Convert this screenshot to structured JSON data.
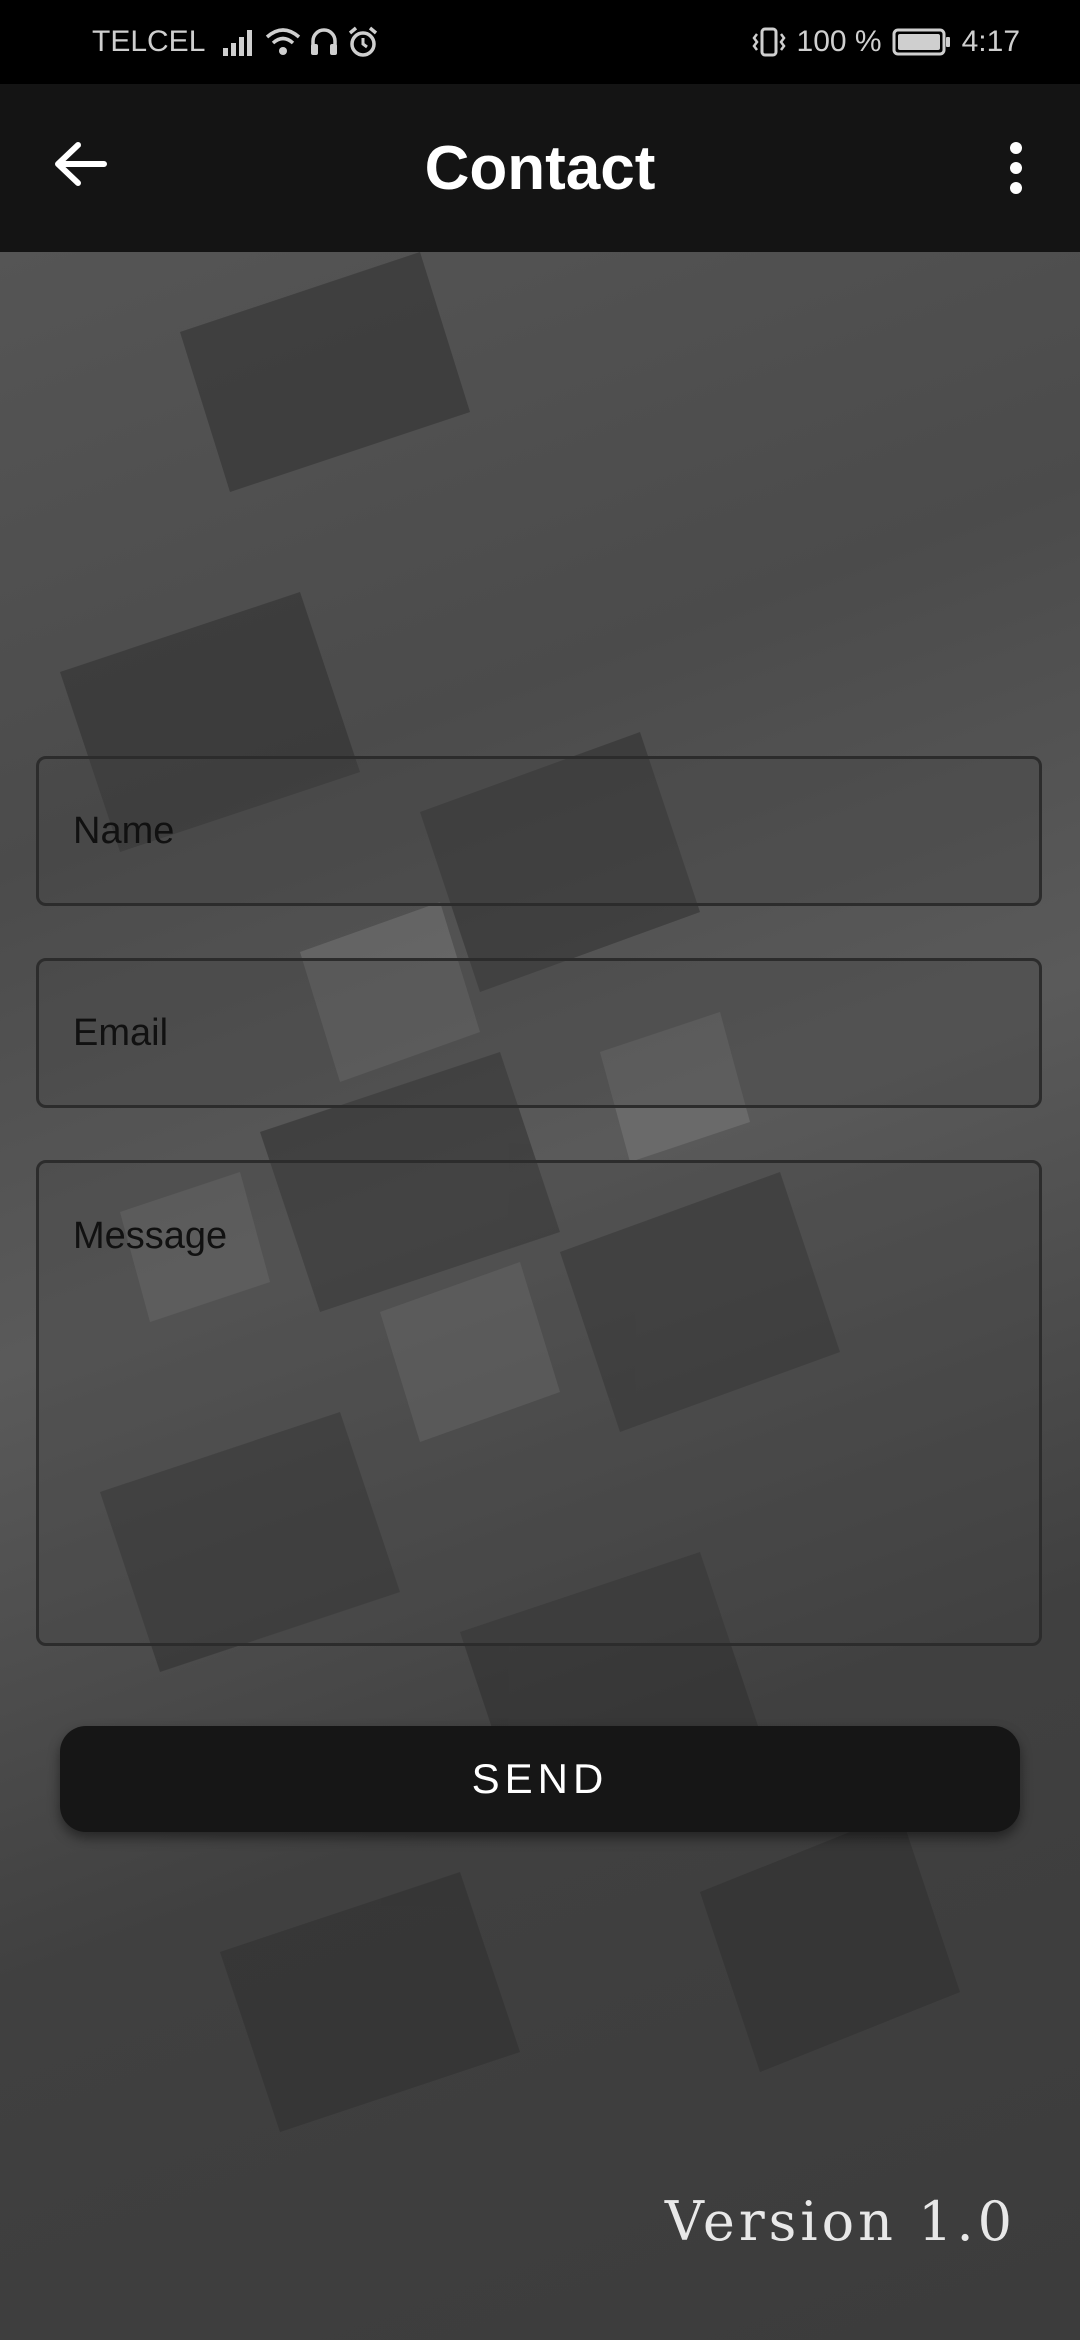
{
  "status_bar": {
    "carrier": "TELCEL",
    "left_icons": [
      "signal-icon",
      "wifi-icon",
      "headset-icon",
      "alarm-icon"
    ],
    "vibrate_icon": "vibrate-icon",
    "battery_percent": "100 %",
    "battery_icon": "battery-icon",
    "time": "4:17"
  },
  "app_bar": {
    "title": "Contact",
    "back_icon": "back-arrow-icon",
    "menu_icon": "more-vert-icon"
  },
  "form": {
    "name_placeholder": "Name",
    "email_placeholder": "Email",
    "message_placeholder": "Message",
    "send_label": "SEND"
  },
  "footer": {
    "version": "Version 1.0"
  },
  "colors": {
    "app_bar": "#141414",
    "status_bar": "#000000",
    "button": "#161616",
    "background": "#4a4a4a"
  }
}
